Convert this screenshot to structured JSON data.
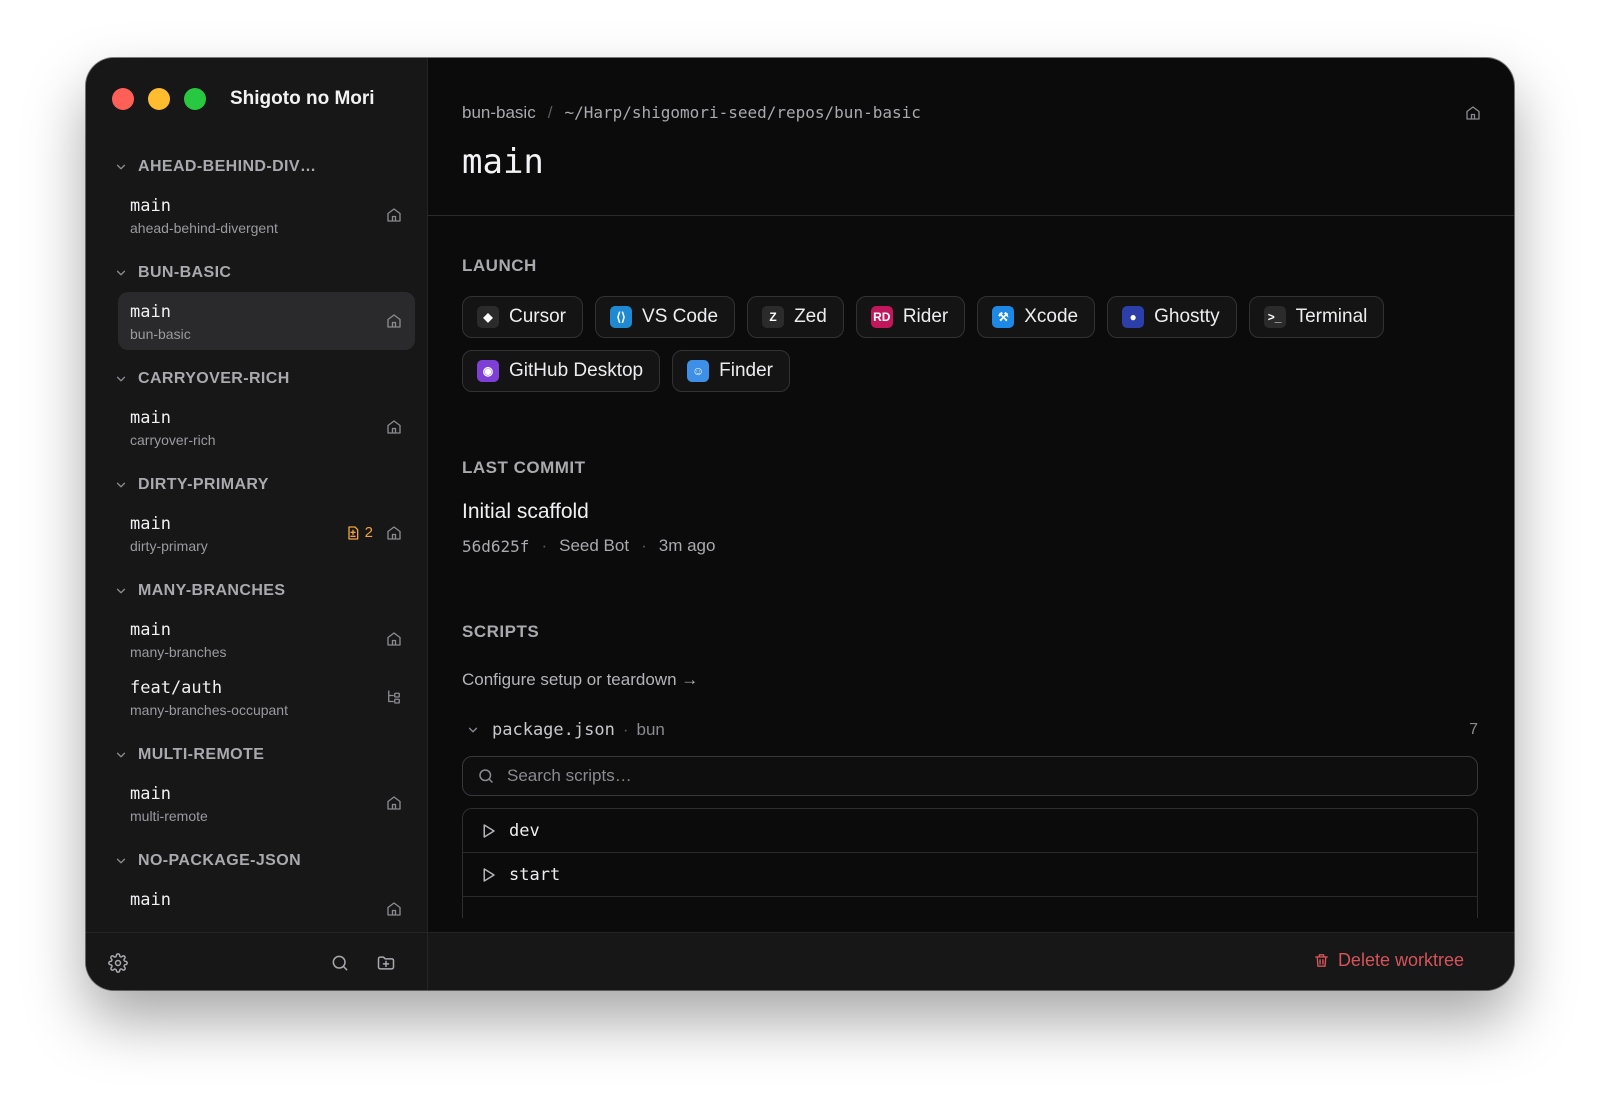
{
  "app": {
    "title": "Shigoto no Mori"
  },
  "sidebar": {
    "groups": [
      {
        "name": "AHEAD-BEHIND-DIV…",
        "worktrees": [
          {
            "branch": "main",
            "repo": "ahead-behind-divergent",
            "icon": "home-icon"
          }
        ]
      },
      {
        "name": "BUN-BASIC",
        "worktrees": [
          {
            "branch": "main",
            "repo": "bun-basic",
            "icon": "home-icon",
            "active": true
          }
        ]
      },
      {
        "name": "CARRYOVER-RICH",
        "worktrees": [
          {
            "branch": "main",
            "repo": "carryover-rich",
            "icon": "home-icon"
          }
        ]
      },
      {
        "name": "DIRTY-PRIMARY",
        "worktrees": [
          {
            "branch": "main",
            "repo": "dirty-primary",
            "icon": "home-icon",
            "badge": "2"
          }
        ]
      },
      {
        "name": "MANY-BRANCHES",
        "worktrees": [
          {
            "branch": "main",
            "repo": "many-branches",
            "icon": "home-icon"
          },
          {
            "branch": "feat/auth",
            "repo": "many-branches-occupant",
            "icon": "worktree-icon"
          }
        ]
      },
      {
        "name": "MULTI-REMOTE",
        "worktrees": [
          {
            "branch": "main",
            "repo": "multi-remote",
            "icon": "home-icon"
          }
        ]
      },
      {
        "name": "NO-PACKAGE-JSON",
        "worktrees": [
          {
            "branch": "main",
            "repo": "",
            "icon": "home-icon"
          }
        ]
      }
    ],
    "footer_icons": [
      "gear-icon",
      "search-icon",
      "new-folder-icon"
    ]
  },
  "main": {
    "breadcrumb": {
      "repo": "bun-basic",
      "separator": "/",
      "path": "~/Harp/shigomori-seed/repos/bun-basic"
    },
    "title": "main",
    "launch": {
      "label": "LAUNCH",
      "apps": [
        {
          "name": "Cursor",
          "icon_color": "#2b2b2b",
          "glyph": "◆"
        },
        {
          "name": "VS Code",
          "icon_color": "#1f8ad2",
          "glyph": "⟨⟩"
        },
        {
          "name": "Zed",
          "icon_color": "#2b2b2b",
          "glyph": "Z"
        },
        {
          "name": "Rider",
          "icon_color": "#c2185b",
          "glyph": "RD"
        },
        {
          "name": "Xcode",
          "icon_color": "#1e88e5",
          "glyph": "⚒"
        },
        {
          "name": "Ghostty",
          "icon_color": "#2c3ea8",
          "glyph": "●"
        },
        {
          "name": "Terminal",
          "icon_color": "#2b2b2b",
          "glyph": ">_"
        },
        {
          "name": "GitHub Desktop",
          "icon_color": "#7e3fd6",
          "glyph": "◉"
        },
        {
          "name": "Finder",
          "icon_color": "#3d8fe8",
          "glyph": "☺"
        }
      ]
    },
    "last_commit": {
      "label": "LAST COMMIT",
      "message": "Initial scaffold",
      "hash": "56d625f",
      "author": "Seed Bot",
      "time": "3m ago",
      "dot": "·"
    },
    "scripts": {
      "label": "SCRIPTS",
      "configure_link": "Configure setup or teardown →",
      "file": "package.json",
      "runtime": "bun",
      "dot": "·",
      "count": "7",
      "search_placeholder": "Search scripts…",
      "items": [
        "dev",
        "start"
      ]
    },
    "footer": {
      "delete_label": "Delete worktree"
    }
  },
  "colors": {
    "accent_warning": "#f2a33a",
    "danger": "#d4545a",
    "window_bg": "#0b0b0c",
    "sidebar_bg": "#171718"
  }
}
